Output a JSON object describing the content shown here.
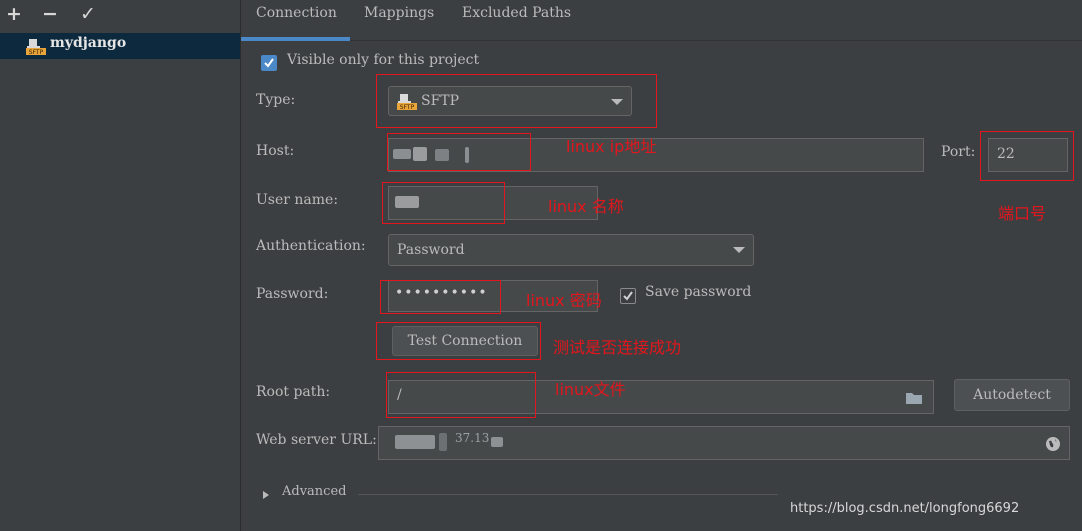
{
  "toolbar": {
    "add_glyph": "+",
    "remove_glyph": "−",
    "apply_glyph": "✓"
  },
  "servers": [
    {
      "name": "mydjango",
      "icon": "sftp-server-icon"
    }
  ],
  "tabs": [
    {
      "label": "Connection",
      "active": true
    },
    {
      "label": "Mappings",
      "active": false
    },
    {
      "label": "Excluded Paths",
      "active": false
    }
  ],
  "connection": {
    "visible_only_label": "Visible only for this project",
    "visible_only_checked": true,
    "type_label": "Type:",
    "type_value": "SFTP",
    "host_label": "Host:",
    "port_label": "Port:",
    "port_value": "22",
    "username_label": "User name:",
    "auth_label": "Authentication:",
    "auth_value": "Password",
    "password_label": "Password:",
    "password_value": "••••••••••",
    "save_password_label": "Save password",
    "save_password_checked": true,
    "test_connection_label": "Test Connection",
    "root_path_label": "Root path:",
    "root_path_value": "/",
    "autodetect_label": "Autodetect",
    "web_url_label": "Web server URL:",
    "web_url_fragment": "37.13",
    "advanced_label": "Advanced"
  },
  "annotations": {
    "host": "linux ip地址",
    "port": "端口号",
    "username": "linux 名称",
    "password": "linux 密码",
    "test": "测试是否连接成功",
    "root": "linux文件"
  },
  "watermark": "https://blog.csdn.net/longfong6692",
  "colors": {
    "background": "#3c3f41",
    "field": "#45494a",
    "selection": "#0d293e",
    "accent": "#4a88c7",
    "annotation_red": "#e2161c",
    "checkbox_blue": "#4a88c7"
  }
}
